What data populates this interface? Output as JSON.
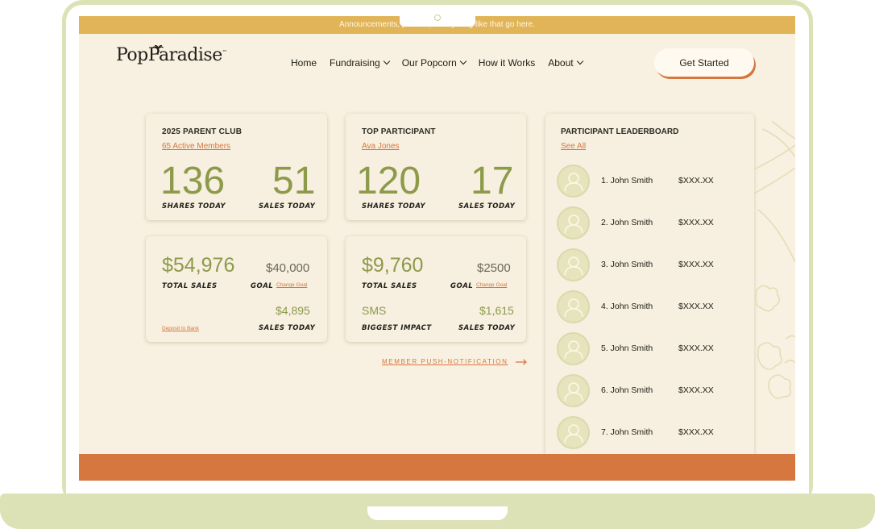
{
  "announcement": "Announcements, promos, or anything like that go here.",
  "logo": {
    "text": "PopParadise",
    "tm": "™"
  },
  "nav": {
    "items": [
      {
        "label": "Home",
        "dropdown": false
      },
      {
        "label": "Fundraising",
        "dropdown": true
      },
      {
        "label": "Our Popcorn",
        "dropdown": true
      },
      {
        "label": "How it Works",
        "dropdown": false
      },
      {
        "label": "About",
        "dropdown": true
      }
    ],
    "cta": "Get Started"
  },
  "club": {
    "title": "2025 PARENT CLUB",
    "link": "65 Active Members",
    "shares_value": "136",
    "shares_label": "SHARES TODAY",
    "sales_value": "51",
    "sales_label": "SALES TODAY"
  },
  "top": {
    "title": "TOP PARTICIPANT",
    "link": "Ava Jones",
    "shares_value": "120",
    "shares_label": "SHARES TODAY",
    "sales_value": "17",
    "sales_label": "SALES TODAY"
  },
  "club_sales": {
    "total": "$54,976",
    "total_label": "TOTAL SALES",
    "goal": "$40,000",
    "goal_label": "GOAL",
    "change_goal": "Change Goal",
    "today": "$4,895",
    "today_label": "SALES TODAY",
    "deposit": "Deposit to Bank"
  },
  "participant_sales": {
    "total": "$9,760",
    "total_label": "TOTAL SALES",
    "goal": "$2500",
    "goal_label": "GOAL",
    "change_goal": "Change Goal",
    "impact": "SMS",
    "impact_label": "BIGGEST IMPACT",
    "today": "$1,615",
    "today_label": "SALES TODAY"
  },
  "push_notification": "MEMBER PUSH-NOTIFICATION",
  "leaderboard": {
    "title": "PARTICIPANT LEADERBOARD",
    "link": "See All",
    "rows": [
      {
        "name": "1. John Smith",
        "amount": "$XXX.XX"
      },
      {
        "name": "2. John Smith",
        "amount": "$XXX.XX"
      },
      {
        "name": "3. John Smith",
        "amount": "$XXX.XX"
      },
      {
        "name": "4. John Smith",
        "amount": "$XXX.XX"
      },
      {
        "name": "5. John Smith",
        "amount": "$XXX.XX"
      },
      {
        "name": "6. John Smith",
        "amount": "$XXX.XX"
      },
      {
        "name": "7. John Smith",
        "amount": "$XXX.XX"
      }
    ]
  },
  "colors": {
    "accent_orange": "#d5773f",
    "accent_green": "#8c9a4a",
    "announcement_bar": "#e2b458",
    "background": "#f8f0e0",
    "laptop_frame": "#dde2b6"
  }
}
